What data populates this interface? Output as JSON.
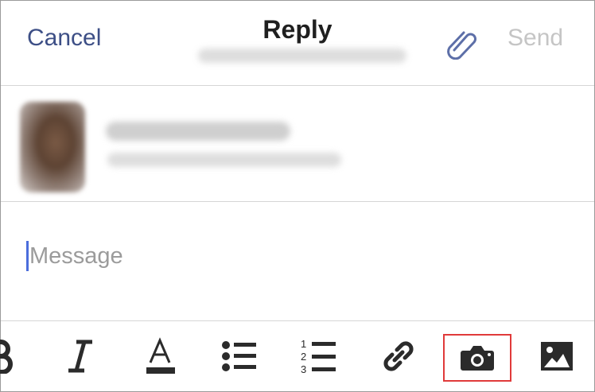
{
  "header": {
    "cancel_label": "Cancel",
    "title": "Reply",
    "send_label": "Send",
    "attach_icon": "paperclip-icon"
  },
  "message": {
    "placeholder": "Message"
  },
  "toolbar": {
    "items": [
      "bold-icon",
      "italic-icon",
      "text-color-icon",
      "bulleted-list-icon",
      "numbered-list-icon",
      "link-icon",
      "camera-icon",
      "image-icon"
    ],
    "italic_glyph": "I",
    "text_color_glyph": "A",
    "numbered_digits": [
      "1",
      "2",
      "3"
    ],
    "highlighted_item": "camera-icon"
  },
  "colors": {
    "accent": "#3d4f86",
    "send_disabled": "#c5c5c5",
    "icon": "#2b2b2b",
    "caret": "#4b6ddc",
    "highlight": "#e03a3a"
  }
}
